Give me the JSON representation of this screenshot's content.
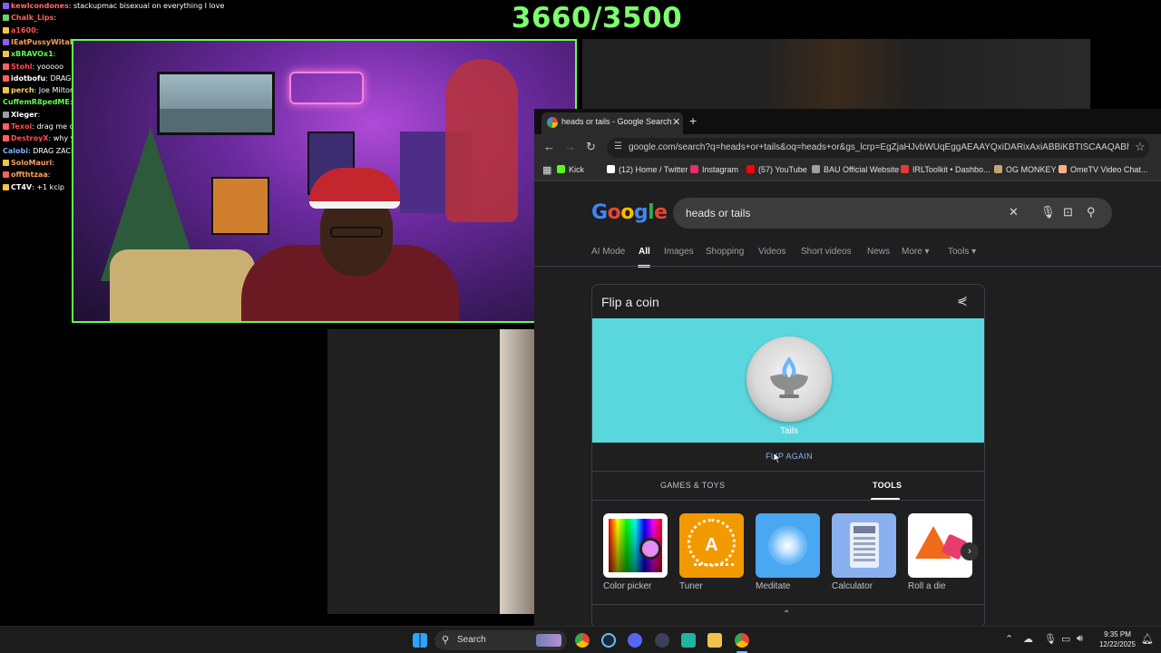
{
  "counter": "3660/3500",
  "chat": [
    {
      "user": "kewlcondones",
      "msg": "stackupmac bisexual on everything I love",
      "color": "#ff6b6b",
      "badge": "#8c5cff"
    },
    {
      "user": "Chalk_Lips",
      "msg": "",
      "color": "#ff5f5f",
      "badge": "#6ad26a"
    },
    {
      "user": "a1600",
      "msg": "",
      "color": "#ff4f4f",
      "badge": "#f4c542"
    },
    {
      "user": "IEatPussyWitaFork",
      "msg": "",
      "color": "#ff9f5a",
      "badge": "#8c5cff"
    },
    {
      "user": "xBRAVOx1",
      "msg": "",
      "color": "#5fff4c",
      "badge": "#f4c542"
    },
    {
      "user": "Stohl",
      "msg": "yooooo",
      "color": "#ff4f4f",
      "badge": "#ff5f5f"
    },
    {
      "user": "idotbofu",
      "msg": "DRAG IDOTBOFU",
      "color": "#ffffff",
      "badge": "#ff5f5f"
    },
    {
      "user": "perch",
      "msg": "Joe Milton?",
      "color": "#ffd95a",
      "badge": "#f4c542"
    },
    {
      "user": "CuffemR8pedME",
      "msg": "DRAG JAKEFUTURE27 FROM VCT @DIPPINZ @LAYKEYZ",
      "color": "#5fff4c",
      "badge": ""
    },
    {
      "user": "Xleger",
      "msg": "",
      "color": "#ffffff",
      "badge": "#9aa0a6"
    },
    {
      "user": "Texoi",
      "msg": "drag me dc name is Kai @cuffem @LAYKEYZ",
      "color": "#ff4f4f",
      "badge": "#ff5f5f"
    },
    {
      "user": "DestroyX",
      "msg": "why you dick watching PONK",
      "color": "#ff4f4f",
      "badge": "#ff5f5f"
    },
    {
      "user": "Calobi",
      "msg": "DRAG ZACH WILSON",
      "color": "#7ab4ff",
      "badge": ""
    },
    {
      "user": "SoloMauri",
      "msg": "",
      "color": "#ff9f5a",
      "badge": "#f4c542"
    },
    {
      "user": "offthtzaa",
      "msg": "",
      "color": "#ff9f5a",
      "badge": "#ff5f5f"
    },
    {
      "user": "CT4V",
      "msg": "+1 kcip",
      "color": "#ffffff",
      "badge": "#f4c542"
    }
  ],
  "browser": {
    "tab_title": "heads or tails - Google Search",
    "tab_close": "✕",
    "new_tab": "+",
    "url": "google.com/search?q=heads+or+tails&oq=heads+or&gs_lcrp=EgZjaHJvbWUqEggAEAAYQxiDARixAxiABBiKBTISCAAQABhDGIMBG...",
    "bookmarks": [
      {
        "label": "Kick",
        "color": "#53fc18"
      },
      {
        "label": "(12) Home / Twitter",
        "color": "#ffffff"
      },
      {
        "label": "Instagram",
        "color": "#e1306c"
      },
      {
        "label": "(57) YouTube",
        "color": "#ff0000"
      },
      {
        "label": "BAU Official Website",
        "color": "#9aa0a6"
      },
      {
        "label": "IRLToolkit • Dashbo...",
        "color": "#e53935"
      },
      {
        "label": "OG MONKEY",
        "color": "#c8a36a"
      },
      {
        "label": "OmeTV Video Chat...",
        "color": "#f4b183"
      }
    ]
  },
  "google": {
    "logo": [
      "G",
      "o",
      "o",
      "g",
      "l",
      "e"
    ],
    "logo_colors": [
      "#4285f4",
      "#ea4335",
      "#fbbc05",
      "#4285f4",
      "#34a853",
      "#ea4335"
    ],
    "query": "heads or tails",
    "tabs": [
      "AI Mode",
      "All",
      "Images",
      "Shopping",
      "Videos",
      "Short videos",
      "News",
      "More ▾",
      "Tools ▾"
    ],
    "active_tab": "All"
  },
  "coin": {
    "title": "Flip a coin",
    "result": "Tails",
    "flip_again": "FLIP AGAIN",
    "categories": [
      "GAMES & TOYS",
      "TOOLS"
    ],
    "active_category": "TOOLS",
    "tools": [
      "Color picker",
      "Tuner",
      "Meditate",
      "Calculator",
      "Roll a die"
    ],
    "tuner_letter": "A",
    "expand": "⌃"
  },
  "taskbar": {
    "search_label": "Search",
    "time": "9:35 PM",
    "date": "12/22/2025"
  },
  "colors": {
    "counter": "#7dff6e",
    "webcam_border": "#5fff4c",
    "coin_background": "#5ad6dd",
    "link_blue": "#8ab4f8"
  }
}
